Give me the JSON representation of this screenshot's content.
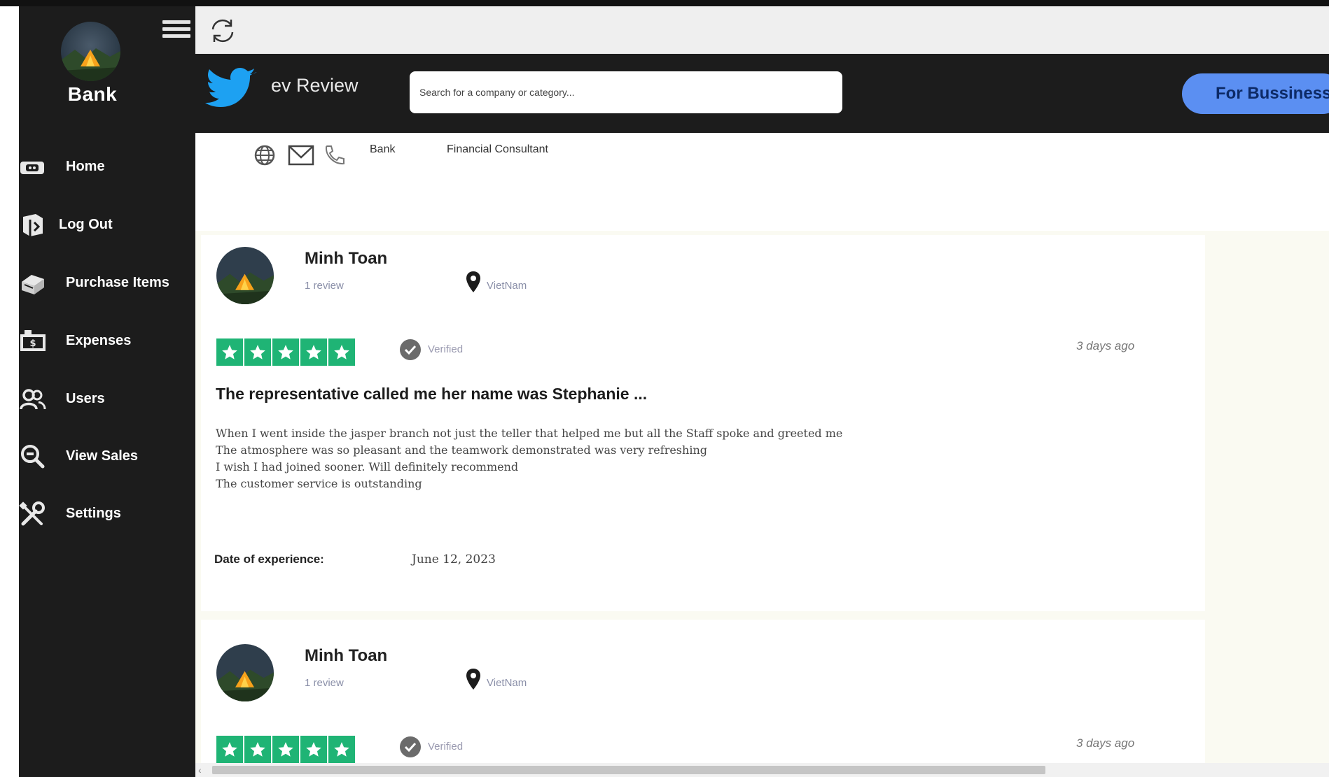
{
  "sidebar": {
    "title": "Bank",
    "items": [
      {
        "label": "Home",
        "icon": "home-icon"
      },
      {
        "label": "Log Out",
        "icon": "logout-icon"
      },
      {
        "label": "Purchase Items",
        "icon": "purchase-icon"
      },
      {
        "label": "Expenses",
        "icon": "expenses-icon"
      },
      {
        "label": "Users",
        "icon": "users-icon"
      },
      {
        "label": "View Sales",
        "icon": "view-sales-icon"
      },
      {
        "label": "Settings",
        "icon": "settings-icon"
      }
    ]
  },
  "header": {
    "brand": "ev Review",
    "search_placeholder": "Search for a company or category...",
    "business_button": "For Bussiness"
  },
  "company_info": {
    "categories": [
      "Bank",
      "Financial Consultant"
    ]
  },
  "reviews": [
    {
      "name": "Minh Toan",
      "review_count": "1 review",
      "location": "VietNam",
      "rating": 5,
      "verified": "Verified",
      "time_ago": "3 days ago",
      "title": "The representative called me her name was Stephanie ...",
      "body_lines": [
        "When I went inside the jasper branch not just the teller that helped me but all the Staff spoke and greeted me",
        "The atmosphere was so pleasant and the teamwork demonstrated was very refreshing",
        "I wish I had joined sooner. Will definitely recommend",
        "The customer service is outstanding"
      ],
      "date_label": "Date of experience:",
      "date_value": "June 12, 2023"
    },
    {
      "name": "Minh Toan",
      "review_count": "1 review",
      "location": "VietNam",
      "rating": 5,
      "verified": "Verified",
      "time_ago": "3 days ago"
    }
  ],
  "colors": {
    "sidebar_bg": "#1c1c1c",
    "header_bg": "#1c1c1c",
    "brand_bird": "#1da1f2",
    "business_button": "#5b8ff2",
    "star_green": "#1fb475"
  }
}
